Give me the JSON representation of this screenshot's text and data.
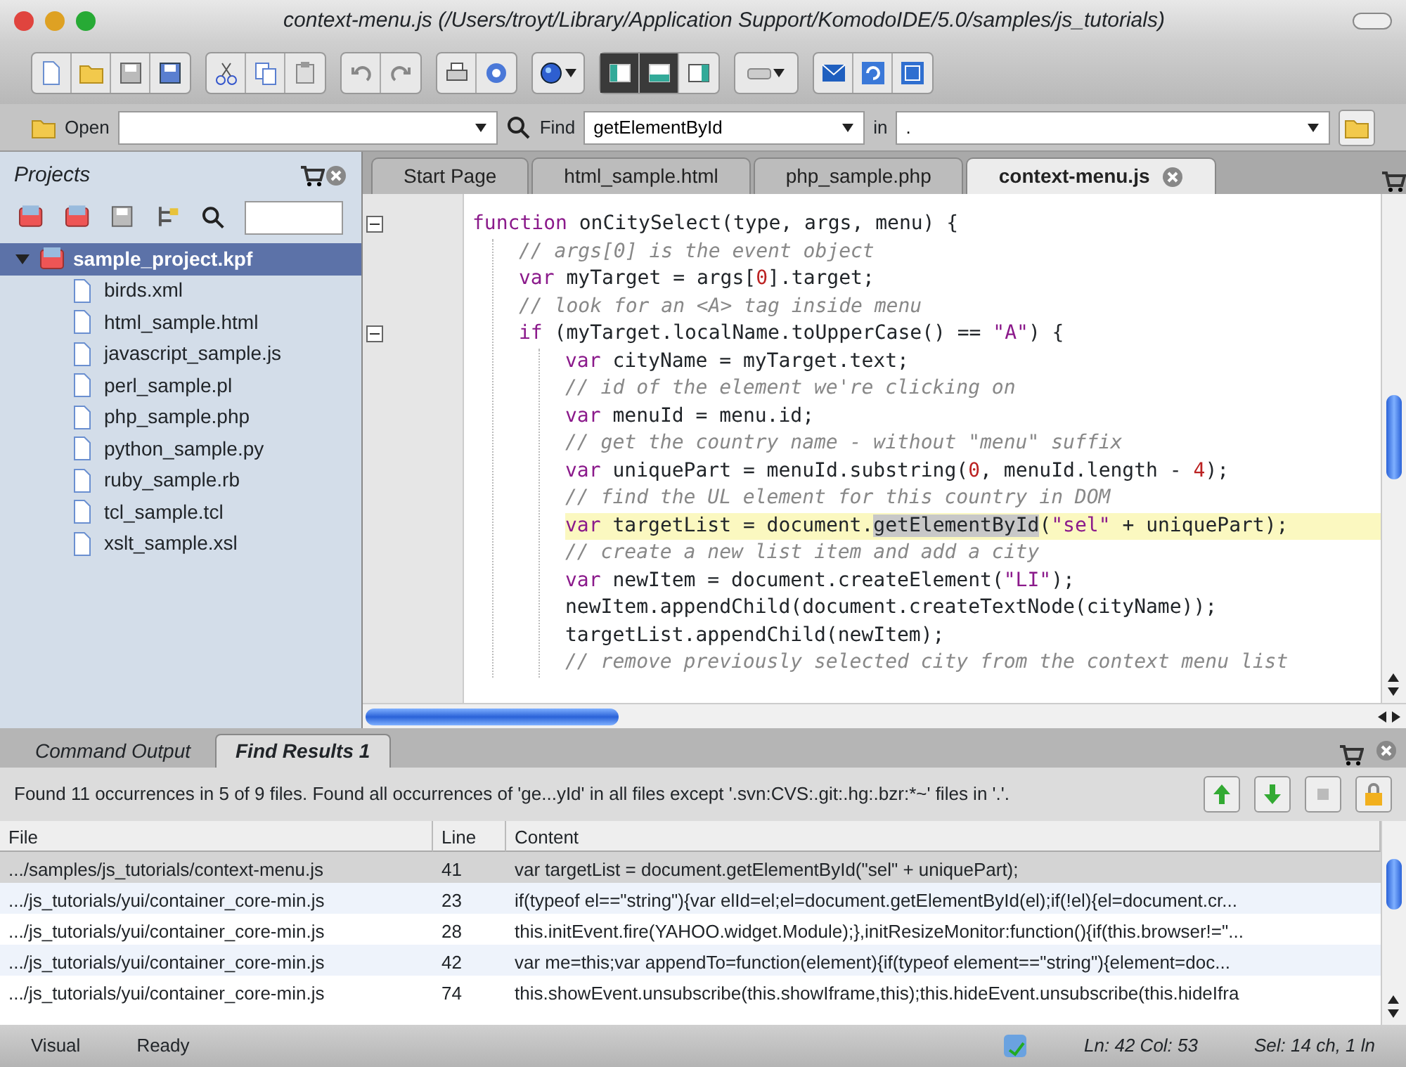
{
  "window": {
    "title": "context-menu.js (/Users/troyt/Library/Application Support/KomodoIDE/5.0/samples/js_tutorials)"
  },
  "toolbar": {
    "pane_toggles": [
      {
        "on": true
      },
      {
        "on": true
      },
      {
        "on": false
      }
    ]
  },
  "find_bar": {
    "open_label": "Open",
    "find_label": "Find",
    "find_value": "getElementById",
    "in_label": "in",
    "in_value": "."
  },
  "projects": {
    "title": "Projects",
    "tree": [
      {
        "label": "sample_project.kpf",
        "kind": "project",
        "expanded": true,
        "selected": true,
        "children": [
          {
            "label": "birds.xml",
            "kind": "file",
            "selected": false
          },
          {
            "label": "html_sample.html",
            "kind": "file",
            "selected": false
          },
          {
            "label": "javascript_sample.js",
            "kind": "file",
            "selected": false
          },
          {
            "label": "perl_sample.pl",
            "kind": "file",
            "selected": false
          },
          {
            "label": "php_sample.php",
            "kind": "file",
            "selected": false
          },
          {
            "label": "python_sample.py",
            "kind": "file",
            "selected": false
          },
          {
            "label": "ruby_sample.rb",
            "kind": "file",
            "selected": false
          },
          {
            "label": "tcl_sample.tcl",
            "kind": "file",
            "selected": false
          },
          {
            "label": "xslt_sample.xsl",
            "kind": "file",
            "selected": false
          }
        ]
      }
    ]
  },
  "editor_tabs": [
    {
      "label": "Start Page",
      "selected": false
    },
    {
      "label": "html_sample.html",
      "selected": false
    },
    {
      "label": "php_sample.php",
      "selected": false
    },
    {
      "label": "context-menu.js",
      "selected": true
    }
  ],
  "code": [
    {
      "current": false,
      "segments": [
        {
          "kind": "keyword",
          "text": "function"
        },
        {
          "kind": "plain",
          "text": " onCitySelect(type, args, menu) {"
        }
      ],
      "children": [
        {
          "current": false,
          "segments": [
            {
              "kind": "comment",
              "text": "// args[0] is the event object"
            }
          ]
        },
        {
          "current": false,
          "segments": [
            {
              "kind": "keyword",
              "text": "var"
            },
            {
              "kind": "plain",
              "text": " myTarget = args["
            },
            {
              "kind": "number",
              "text": "0"
            },
            {
              "kind": "plain",
              "text": "].target;"
            }
          ]
        },
        {
          "current": false,
          "segments": [
            {
              "kind": "comment",
              "text": "// look for an <A> tag inside menu"
            }
          ]
        },
        {
          "current": false,
          "segments": [
            {
              "kind": "keyword",
              "text": "if"
            },
            {
              "kind": "plain",
              "text": " (myTarget.localName.toUpperCase() == "
            },
            {
              "kind": "string",
              "text": "\"A\""
            },
            {
              "kind": "plain",
              "text": ") {"
            }
          ],
          "children": [
            {
              "current": false,
              "segments": [
                {
                  "kind": "keyword",
                  "text": "var"
                },
                {
                  "kind": "plain",
                  "text": " cityName = myTarget.text;"
                }
              ]
            },
            {
              "current": false,
              "segments": [
                {
                  "kind": "comment",
                  "text": "// id of the element we're clicking on"
                }
              ]
            },
            {
              "current": false,
              "segments": [
                {
                  "kind": "keyword",
                  "text": "var"
                },
                {
                  "kind": "plain",
                  "text": " menuId = menu.id;"
                }
              ]
            },
            {
              "current": false,
              "segments": [
                {
                  "kind": "comment",
                  "text": "// get the country name - without \"menu\" suffix"
                }
              ]
            },
            {
              "current": false,
              "segments": [
                {
                  "kind": "keyword",
                  "text": "var"
                },
                {
                  "kind": "plain",
                  "text": " uniquePart = menuId.substring("
                },
                {
                  "kind": "number",
                  "text": "0"
                },
                {
                  "kind": "plain",
                  "text": ", menuId.length - "
                },
                {
                  "kind": "number",
                  "text": "4"
                },
                {
                  "kind": "plain",
                  "text": ");"
                }
              ]
            },
            {
              "current": false,
              "segments": [
                {
                  "kind": "comment",
                  "text": "// find the UL element for this country in DOM"
                }
              ]
            },
            {
              "current": true,
              "segments": [
                {
                  "kind": "keyword",
                  "text": "var"
                },
                {
                  "kind": "plain",
                  "text": " targetList = document."
                },
                {
                  "kind": "match",
                  "text": "getElementById"
                },
                {
                  "kind": "plain",
                  "text": "("
                },
                {
                  "kind": "string",
                  "text": "\"sel\""
                },
                {
                  "kind": "plain",
                  "text": " + uniquePart);"
                }
              ]
            },
            {
              "current": false,
              "segments": [
                {
                  "kind": "comment",
                  "text": "// create a new list item and add a city"
                }
              ]
            },
            {
              "current": false,
              "segments": [
                {
                  "kind": "keyword",
                  "text": "var"
                },
                {
                  "kind": "plain",
                  "text": " newItem = document.createElement("
                },
                {
                  "kind": "string",
                  "text": "\"LI\""
                },
                {
                  "kind": "plain",
                  "text": ");"
                }
              ]
            },
            {
              "current": false,
              "segments": [
                {
                  "kind": "plain",
                  "text": "newItem.appendChild(document.createTextNode(cityName));"
                }
              ]
            },
            {
              "current": false,
              "segments": [
                {
                  "kind": "plain",
                  "text": "targetList.appendChild(newItem);"
                }
              ]
            },
            {
              "current": false,
              "segments": [
                {
                  "kind": "comment",
                  "text": "// remove previously selected city from the context menu list"
                }
              ]
            }
          ]
        }
      ]
    }
  ],
  "bottom_tabs": [
    {
      "label": "Command Output",
      "selected": false
    },
    {
      "label": "Find Results 1",
      "selected": true
    }
  ],
  "find_results": {
    "message": "Found 11 occurrences in 5 of 9 files. Found all occurrences of 'ge...yId' in all files except '.svn:CVS:.git:.hg:.bzr:*~' files in '.'.",
    "columns": [
      "File",
      "Line",
      "Content"
    ],
    "rows": [
      {
        "file": ".../samples/js_tutorials/context-menu.js",
        "line": "41",
        "content": "var targetList = document.getElementById(\"sel\" + uniquePart);",
        "selected": true
      },
      {
        "file": ".../js_tutorials/yui/container_core-min.js",
        "line": "23",
        "content": "if(typeof el==\"string\"){var elId=el;el=document.getElementById(el);if(!el){el=document.cr...",
        "selected": false
      },
      {
        "file": ".../js_tutorials/yui/container_core-min.js",
        "line": "28",
        "content": "this.initEvent.fire(YAHOO.widget.Module);},initResizeMonitor:function(){if(this.browser!=\"...",
        "selected": false
      },
      {
        "file": ".../js_tutorials/yui/container_core-min.js",
        "line": "42",
        "content": "var me=this;var appendTo=function(element){if(typeof element==\"string\"){element=doc...",
        "selected": false
      },
      {
        "file": ".../js_tutorials/yui/container_core-min.js",
        "line": "74",
        "content": "this.showEvent.unsubscribe(this.showIframe,this);this.hideEvent.unsubscribe(this.hideIfra",
        "selected": false
      }
    ]
  },
  "status_bar": {
    "mode": "Visual",
    "state": "Ready",
    "position": "Ln: 42 Col: 53",
    "selection": "Sel: 14 ch, 1 ln"
  }
}
